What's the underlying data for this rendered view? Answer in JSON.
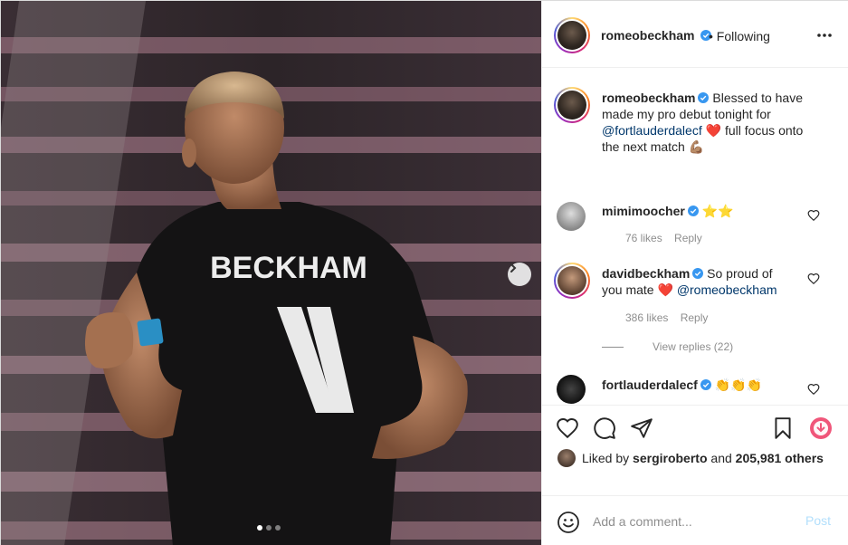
{
  "post": {
    "author": "romeobeckham",
    "follow_status": "• Following",
    "photo": {
      "jersey_name": "BECKHAM",
      "jersey_number": "11"
    }
  },
  "caption": {
    "username": "romeobeckham",
    "text_line1": "Blessed to have",
    "text_line2": "made my pro debut tonight for",
    "mention": "@fortlauderdalecf",
    "heart": "❤️",
    "text_line3a": "full focus onto",
    "text_line4": "the next match",
    "muscle": "💪🏽"
  },
  "comments": [
    {
      "username": "mimimoocher",
      "text": "⭐⭐",
      "likes": "76 likes",
      "reply": "Reply"
    },
    {
      "username": "davidbeckham",
      "text_line1": "So proud of",
      "text_line2": "you mate",
      "heart": "❤️",
      "mention": "@romeobeckham",
      "likes": "386 likes",
      "reply": "Reply",
      "view_replies": "View replies (22)"
    },
    {
      "username": "fortlauderdalecf",
      "text": "👏👏👏"
    }
  ],
  "likes": {
    "prefix": "Liked by",
    "user": "sergiroberto",
    "middle": "and",
    "others": "205,981 others"
  },
  "comment_box": {
    "placeholder": "Add a comment...",
    "post_label": "Post"
  },
  "carousel": {
    "slides": 3,
    "active": 1
  },
  "colors": {
    "verified": "#3897f0",
    "mention": "#00376b",
    "heart_red": "#ed4956",
    "post_disabled": "#b2dffc",
    "meta_gray": "#8e8e8e"
  }
}
